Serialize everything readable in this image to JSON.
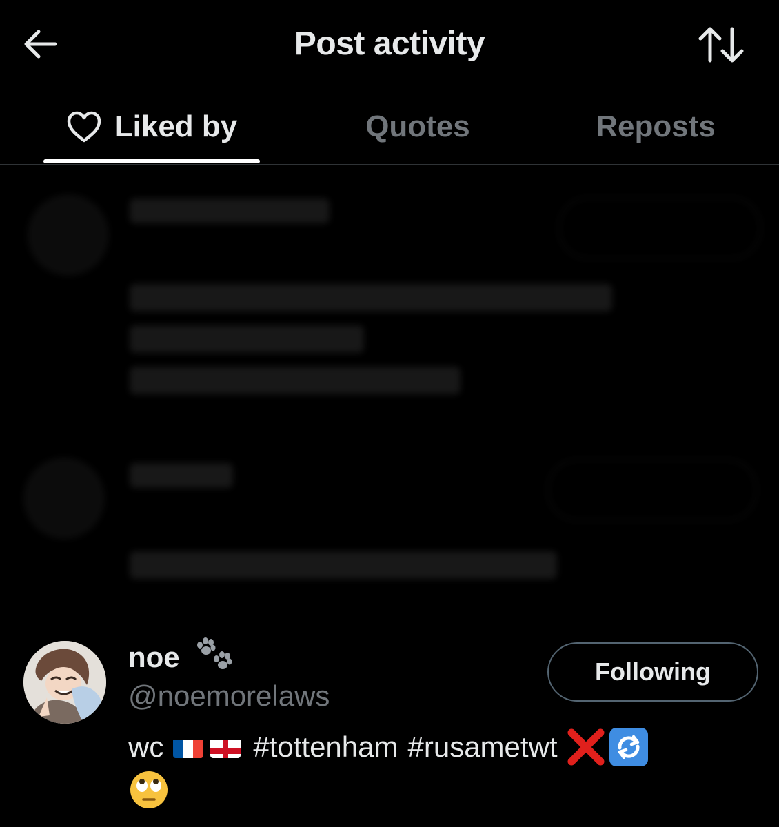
{
  "header": {
    "title": "Post activity",
    "back_icon": "arrow-left-icon",
    "sort_icon": "sort-arrows-icon"
  },
  "tabs": [
    {
      "label": "Liked by",
      "icon": "heart-outline-icon",
      "active": true
    },
    {
      "label": "Quotes",
      "active": false
    },
    {
      "label": "Reposts",
      "active": false
    }
  ],
  "users": [
    {
      "display_name": "noe",
      "display_name_emoji": "paw-prints-icon",
      "handle": "@noemorelaws",
      "button_label": "Following",
      "bio": {
        "prefix": "wc",
        "flags": [
          "flag-france-icon",
          "flag-england-icon"
        ],
        "hashtags": [
          "#tottenham",
          "#rusametwt"
        ],
        "emojis": [
          "cross-mark-icon",
          "repeat-arrows-icon",
          "eye-roll-face-icon"
        ]
      }
    }
  ],
  "colors": {
    "background": "#000000",
    "primary_text": "#e7e9ea",
    "secondary_text": "#71767b",
    "divider": "#2f3336",
    "button_border": "#536471"
  }
}
